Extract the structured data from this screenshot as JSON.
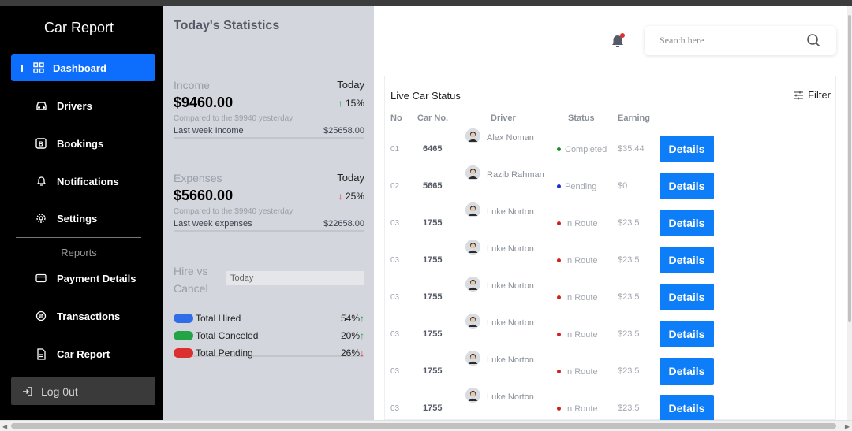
{
  "sidebar": {
    "brand": "Car Report",
    "items": [
      {
        "label": "Dashboard",
        "icon": "grid-icon"
      },
      {
        "label": "Drivers",
        "icon": "car-icon"
      },
      {
        "label": "Bookings",
        "icon": "bookings-icon"
      },
      {
        "label": "Notifications",
        "icon": "bell-icon"
      },
      {
        "label": "Settings",
        "icon": "gear-icon"
      }
    ],
    "reports_label": "Reports",
    "report_items": [
      {
        "label": "Payment Details",
        "icon": "card-icon"
      },
      {
        "label": "Transactions",
        "icon": "transactions-icon"
      },
      {
        "label": "Car Report",
        "icon": "document-icon"
      }
    ],
    "logout": "Log 0ut"
  },
  "stats": {
    "title": "Today's Statistics",
    "income": {
      "label": "Income",
      "period": "Today",
      "amount": "$9460.00",
      "change": "15%",
      "compare": "Compared to the $9940 yesterday",
      "week_label": "Last week Income",
      "week_value": "$25658.00"
    },
    "expenses": {
      "label": "Expenses",
      "period": "Today",
      "amount": "$5660.00",
      "change": "25%",
      "compare": "Compared to the $9940 yesterday",
      "week_label": "Last week expenses",
      "week_value": "$22658.00"
    },
    "hire": {
      "title": "Hire vs Cancel",
      "select": "Today",
      "rows": [
        {
          "name": "Total Hired",
          "value": "54%",
          "color": "#2f6ee8"
        },
        {
          "name": "Total Canceled",
          "value": "20%",
          "color": "#22a447"
        },
        {
          "name": "Total Pending",
          "value": "26%",
          "color": "#dc2f2f"
        }
      ]
    }
  },
  "main": {
    "search_placeholder": "Search here",
    "panel_title": "Live Car Status",
    "filter_label": "Filter",
    "headers": {
      "no": "No",
      "car": "Car No.",
      "driver": "Driver",
      "status": "Status",
      "earning": "Earning"
    },
    "button_label": "Details",
    "rows": [
      {
        "no": "01",
        "car": "6465",
        "driver": "Alex Noman",
        "status": "Completed",
        "status_color": "#1b8a2e",
        "earning": "$35.44"
      },
      {
        "no": "02",
        "car": "5665",
        "driver": "Razib Rahman",
        "status": "Pending",
        "status_color": "#1b2fcf",
        "earning": "$0"
      },
      {
        "no": "03",
        "car": "1755",
        "driver": "Luke Norton",
        "status": "In Route",
        "status_color": "#d0201e",
        "earning": "$23.5"
      },
      {
        "no": "03",
        "car": "1755",
        "driver": "Luke Norton",
        "status": "In Route",
        "status_color": "#d0201e",
        "earning": "$23.5"
      },
      {
        "no": "03",
        "car": "1755",
        "driver": "Luke Norton",
        "status": "In Route",
        "status_color": "#d0201e",
        "earning": "$23.5"
      },
      {
        "no": "03",
        "car": "1755",
        "driver": "Luke Norton",
        "status": "In Route",
        "status_color": "#d0201e",
        "earning": "$23.5"
      },
      {
        "no": "03",
        "car": "1755",
        "driver": "Luke Norton",
        "status": "In Route",
        "status_color": "#d0201e",
        "earning": "$23.5"
      },
      {
        "no": "03",
        "car": "1755",
        "driver": "Luke Norton",
        "status": "In Route",
        "status_color": "#d0201e",
        "earning": "$23.5"
      }
    ]
  }
}
